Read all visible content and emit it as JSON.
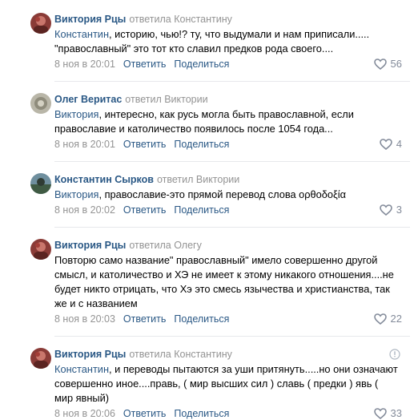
{
  "comments": [
    {
      "author": "Виктория Рцы",
      "reply_to": "ответила Константину",
      "mention": "Константин",
      "text": ", историю, чью!? ту, что выдумали и нам приписали..... \"православный\" это тот кто славил предков рода своего....",
      "date": "8 ноя в 20:01",
      "reply_label": "Ответить",
      "share_label": "Поделиться",
      "likes": "56",
      "avatar_color": "#b5574e"
    },
    {
      "author": "Олег Веритас",
      "reply_to": "ответил Виктории",
      "mention": "Виктория",
      "text": ", интересно, как русь могла быть православной, если православие и католичество появилось после 1054 года...",
      "date": "8 ноя в 20:01",
      "reply_label": "Ответить",
      "share_label": "Поделиться",
      "likes": "4",
      "avatar_color": "#9c9c8e"
    },
    {
      "author": "Константин Сырков",
      "reply_to": "ответил Виктории",
      "mention": "Виктория",
      "text": ", православие-это прямой перевод слова ορθοδοξία",
      "date": "8 ноя в 20:02",
      "reply_label": "Ответить",
      "share_label": "Поделиться",
      "likes": "3",
      "avatar_color": "#5d7a6a"
    },
    {
      "author": "Виктория Рцы",
      "reply_to": "ответила Олегу",
      "mention": "",
      "text": "Повторю само название\" православный\" имело совершенно другой смысл, и католичество и ХЭ не имеет к этому никакого отношения....не будет никто отрицать, что Хэ это смесь язычества и христианства, так же и с названием",
      "date": "8 ноя в 20:03",
      "reply_label": "Ответить",
      "share_label": "Поделиться",
      "likes": "22",
      "avatar_color": "#b5574e"
    },
    {
      "author": "Виктория Рцы",
      "reply_to": "ответила Константину",
      "mention": "Константин",
      "text": ", и переводы пытаются за уши притянуть.....но они означают совершенно иное....правь, ( мир высших сил ) славь ( предки ) явь ( мир явный)",
      "date": "8 ноя в 20:06",
      "reply_label": "Ответить",
      "share_label": "Поделиться",
      "likes": "33",
      "avatar_color": "#b5574e"
    }
  ],
  "colors": {
    "link": "#2a5885",
    "muted": "#939393",
    "divider": "#e7e8ec"
  },
  "icons": [
    "avatar",
    "heart-icon",
    "info-icon"
  ]
}
